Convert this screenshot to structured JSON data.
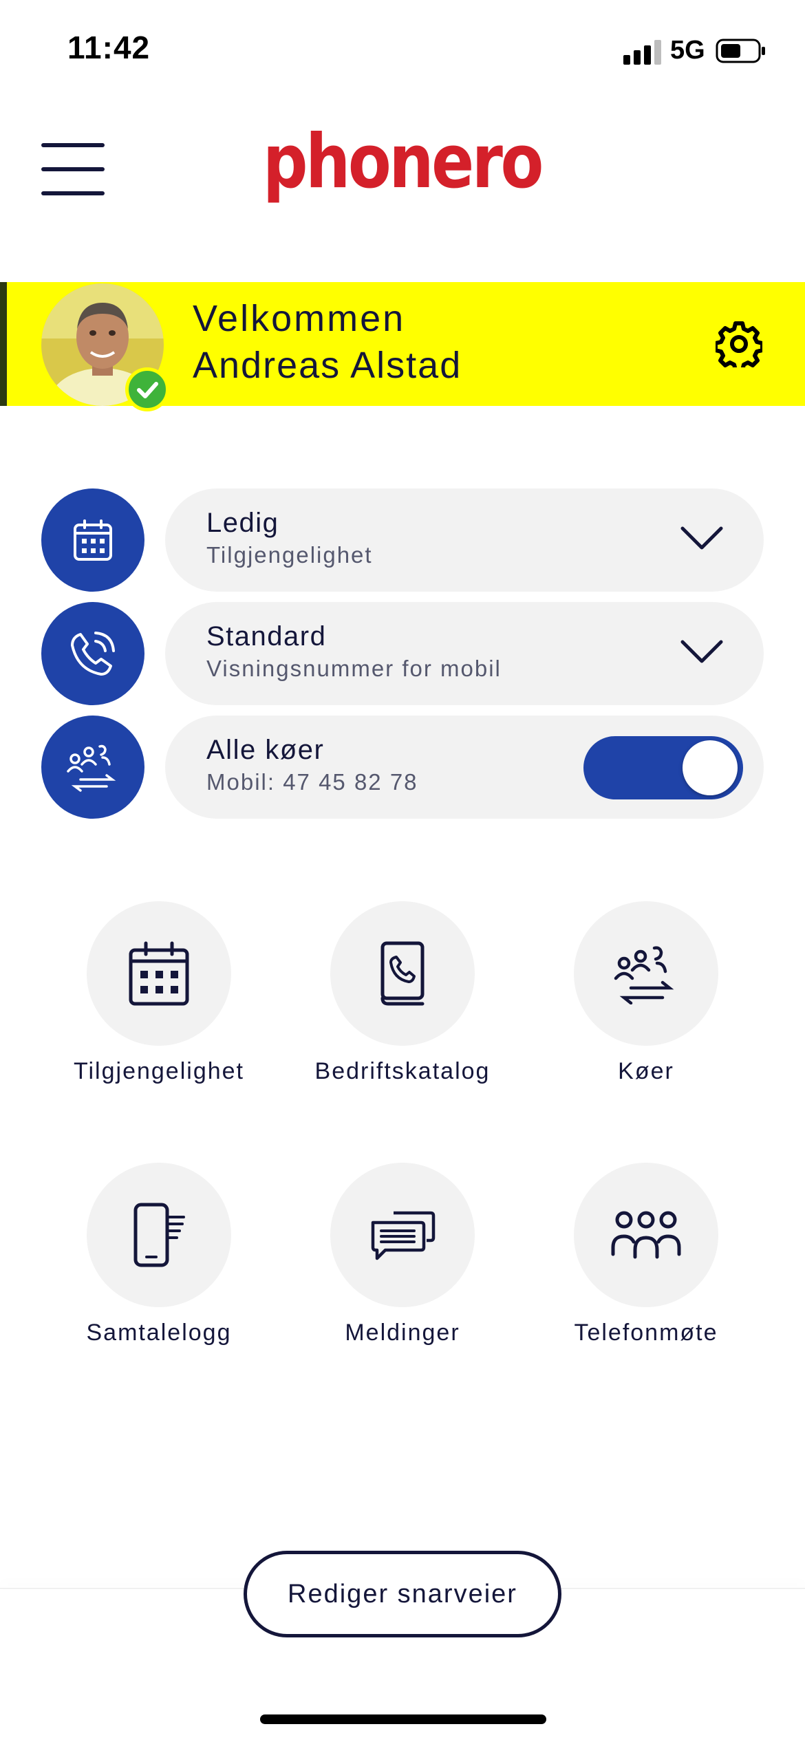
{
  "status_bar": {
    "time": "11:42",
    "network": "5G"
  },
  "header": {
    "logo_text": "phonero",
    "brand_color": "#d4202a"
  },
  "banner": {
    "greeting": "Velkommen",
    "user_name": "Andreas Alstad",
    "background_color": "#ffff00",
    "presence": "available"
  },
  "settings_rows": [
    {
      "title": "Ledig",
      "subtitle": "Tilgjengelighet",
      "icon": "calendar-icon",
      "control": "dropdown"
    },
    {
      "title": "Standard",
      "subtitle": "Visningsnummer for mobil",
      "icon": "phone-ringing-icon",
      "control": "dropdown"
    },
    {
      "title": "Alle køer",
      "subtitle": "Mobil: 47 45 82 78",
      "icon": "queue-icon",
      "control": "toggle",
      "toggle_on": true
    }
  ],
  "shortcuts": [
    {
      "label": "Tilgjengelighet",
      "icon": "calendar-icon"
    },
    {
      "label": "Bedriftskatalog",
      "icon": "phonebook-icon"
    },
    {
      "label": "Køer",
      "icon": "queue-icon"
    },
    {
      "label": "Samtalelogg",
      "icon": "call-log-icon"
    },
    {
      "label": "Meldinger",
      "icon": "messages-icon"
    },
    {
      "label": "Telefonmøte",
      "icon": "conference-icon"
    }
  ],
  "footer": {
    "edit_shortcuts_label": "Rediger snarveier"
  },
  "colors": {
    "accent_blue": "#1f43a8",
    "navy_text": "#14163a",
    "pill_gray": "#f2f2f2",
    "online_green": "#3fb33a"
  }
}
